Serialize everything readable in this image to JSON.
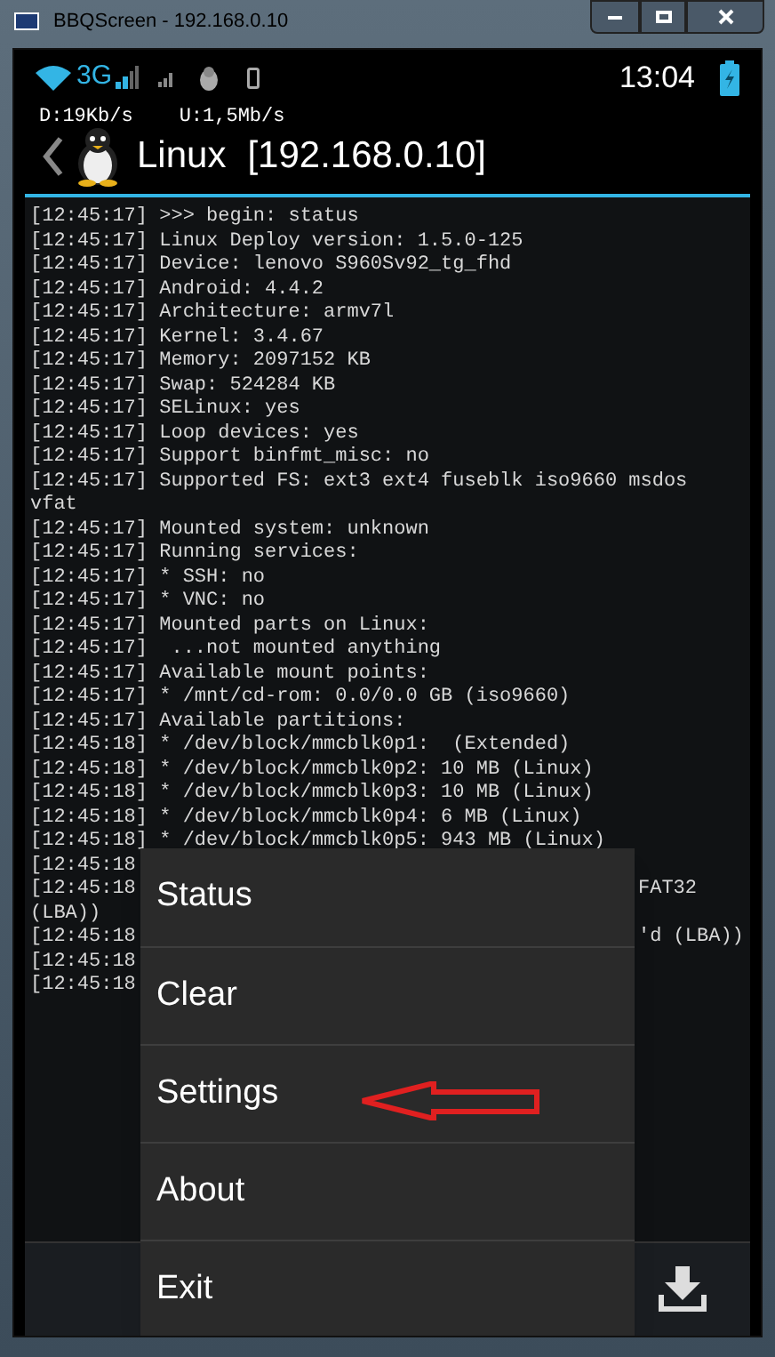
{
  "window": {
    "title": "BBQScreen - 192.168.0.10"
  },
  "status_bar": {
    "network": "3G",
    "time": "13:04"
  },
  "speeds": {
    "download": "D:19Kb/s",
    "upload": "U:1,5Mb/s"
  },
  "action_bar": {
    "title": "Linux",
    "address": "[192.168.0.10]"
  },
  "log": [
    {
      "kind": "line",
      "text": "[12:45:17] >>> begin: status"
    },
    {
      "kind": "line",
      "text": "[12:45:17] Linux Deploy version: 1.5.0-125"
    },
    {
      "kind": "line",
      "text": "[12:45:17] Device: lenovo S960Sv92_tg_fhd"
    },
    {
      "kind": "line",
      "text": "[12:45:17] Android: 4.4.2"
    },
    {
      "kind": "line",
      "text": "[12:45:17] Architecture: armv7l"
    },
    {
      "kind": "line",
      "text": "[12:45:17] Kernel: 3.4.67"
    },
    {
      "kind": "line",
      "text": "[12:45:17] Memory: 2097152 KB"
    },
    {
      "kind": "line",
      "text": "[12:45:17] Swap: 524284 KB"
    },
    {
      "kind": "line",
      "text": "[12:45:17] SELinux: yes"
    },
    {
      "kind": "line",
      "text": "[12:45:17] Loop devices: yes"
    },
    {
      "kind": "line",
      "text": "[12:45:17] Support binfmt_misc: no"
    },
    {
      "kind": "line",
      "text": "[12:45:17] Supported FS: ext3 ext4 fuseblk iso9660 msdos"
    },
    {
      "kind": "line",
      "text": "vfat"
    },
    {
      "kind": "line",
      "text": "[12:45:17] Mounted system: unknown"
    },
    {
      "kind": "line",
      "text": "[12:45:17] Running services:"
    },
    {
      "kind": "line",
      "text": "[12:45:17] * SSH: no"
    },
    {
      "kind": "line",
      "text": "[12:45:17] * VNC: no"
    },
    {
      "kind": "line",
      "text": "[12:45:17] Mounted parts on Linux:"
    },
    {
      "kind": "line",
      "text": "[12:45:17]  ...not mounted anything"
    },
    {
      "kind": "line",
      "text": "[12:45:17] Available mount points:"
    },
    {
      "kind": "line",
      "text": "[12:45:17] * /mnt/cd-rom: 0.0/0.0 GB (iso9660)"
    },
    {
      "kind": "line",
      "text": "[12:45:17] Available partitions:"
    },
    {
      "kind": "line",
      "text": "[12:45:18] * /dev/block/mmcblk0p1:  (Extended)"
    },
    {
      "kind": "line",
      "text": "[12:45:18] * /dev/block/mmcblk0p2: 10 MB (Linux)"
    },
    {
      "kind": "line",
      "text": "[12:45:18] * /dev/block/mmcblk0p3: 10 MB (Linux)"
    },
    {
      "kind": "line",
      "text": "[12:45:18] * /dev/block/mmcblk0p4: 6 MB (Linux)"
    },
    {
      "kind": "line",
      "text": "[12:45:18] * /dev/block/mmcblk0p5: 943 MB (Linux)"
    },
    {
      "kind": "split",
      "left": "[12:45:18"
    },
    {
      "kind": "split",
      "left": "[12:45:18",
      "right": "FAT32"
    },
    {
      "kind": "line",
      "text": "(LBA))"
    },
    {
      "kind": "split",
      "left": "[12:45:18",
      "right": "'d (LBA))"
    },
    {
      "kind": "split",
      "left": "[12:45:18"
    },
    {
      "kind": "split",
      "left": "[12:45:18"
    }
  ],
  "menu": [
    {
      "label": "Status"
    },
    {
      "label": "Clear"
    },
    {
      "label": "Settings"
    },
    {
      "label": "About"
    },
    {
      "label": "Exit"
    }
  ]
}
